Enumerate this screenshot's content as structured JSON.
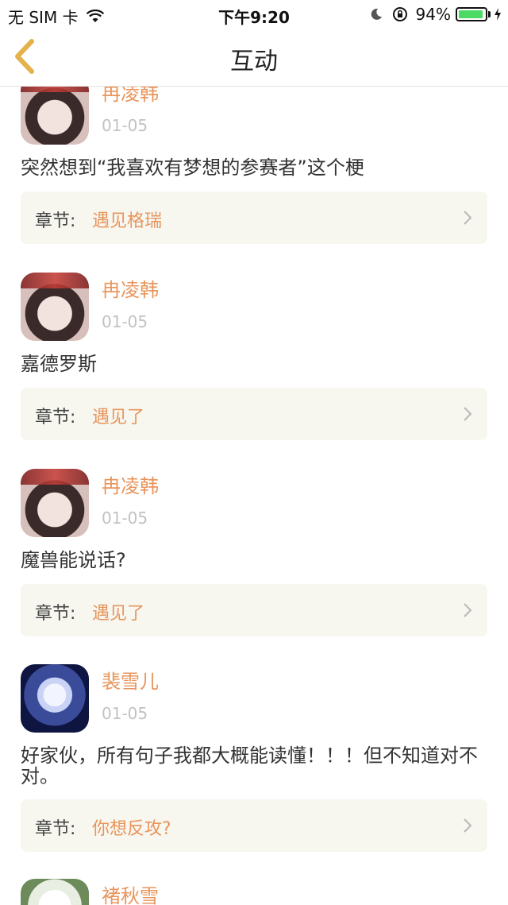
{
  "status_bar": {
    "carrier": "无 SIM 卡",
    "time": "下午9:20",
    "battery": "94%",
    "battery_level": 0.94,
    "battery_color": "#4cd964"
  },
  "nav": {
    "title": "互动"
  },
  "comments": [
    {
      "author": "冉凌韩",
      "date": "01-05",
      "text": "突然想到“我喜欢有梦想的参赛者”这个梗",
      "chapter_label": "章节:",
      "chapter": "遇见格瑞"
    },
    {
      "author": "冉凌韩",
      "date": "01-05",
      "text": "嘉德罗斯",
      "chapter_label": "章节:",
      "chapter": "遇见了"
    },
    {
      "author": "冉凌韩",
      "date": "01-05",
      "text": "魔兽能说话?",
      "chapter_label": "章节:",
      "chapter": "遇见了"
    },
    {
      "author": "裴雪儿",
      "date": "01-05",
      "text": "好家伙，所有句子我都大概能读懂！！！但不知道对不对。",
      "chapter_label": "章节:",
      "chapter": "你想反攻?"
    },
    {
      "author": "褚秋雪"
    }
  ],
  "colors": {
    "accent": "#e8955c",
    "back_arrow": "#e3b24a",
    "chapter_bg": "#f7f7f0",
    "date": "#c2c2c2"
  }
}
